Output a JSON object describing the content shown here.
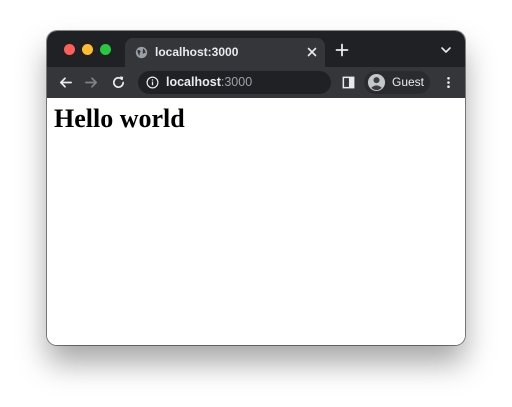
{
  "browser": {
    "tab": {
      "title": "localhost:3000"
    },
    "address_bar": {
      "host": "localhost",
      "port": ":3000"
    },
    "profile": {
      "label": "Guest"
    }
  },
  "page": {
    "heading": "Hello world"
  },
  "colors": {
    "frame": "#202124",
    "toolbar": "#35363a",
    "text_light": "#e8eaed",
    "text_muted": "#9aa0a6",
    "close": "#ff5f57",
    "minimize": "#febc2e",
    "maximize": "#28c840"
  },
  "icons": [
    "globe-icon",
    "close-icon",
    "plus-icon",
    "chevron-down-icon",
    "back-arrow-icon",
    "forward-arrow-icon",
    "reload-icon",
    "info-icon",
    "side-panel-icon",
    "avatar-icon",
    "more-vertical-icon"
  ]
}
